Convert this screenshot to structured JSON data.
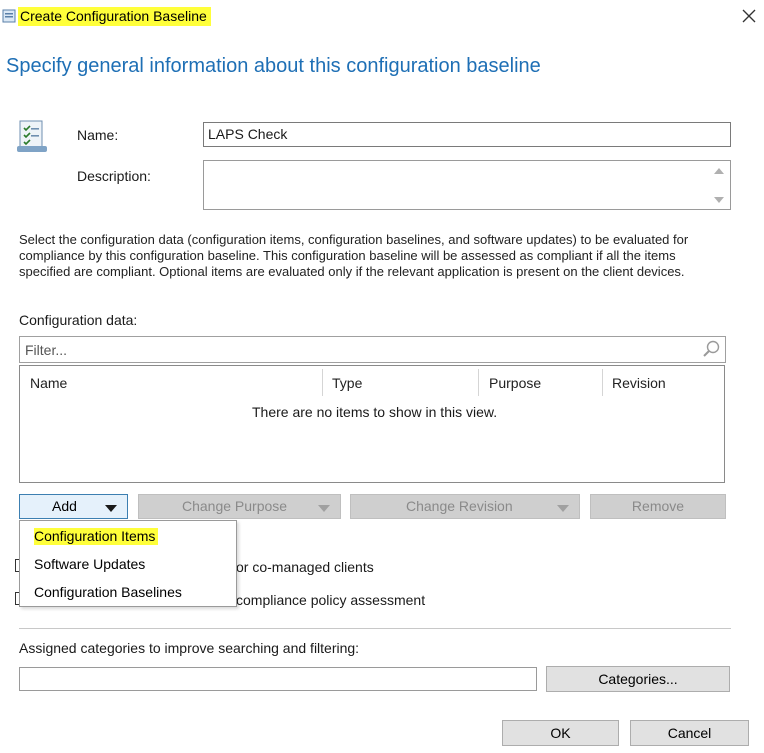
{
  "window": {
    "title": "Create Configuration Baseline",
    "heading": "Specify general information about this configuration baseline"
  },
  "form": {
    "name_label": "Name:",
    "name_value": "LAPS Check",
    "description_label": "Description:",
    "description_value": "",
    "info_line1": "Select the configuration data (configuration items, configuration baselines, and software updates) to be evaluated for",
    "info_line2": "compliance by this configuration baseline. This configuration baseline will be assessed as compliant if all the items",
    "info_line3": "specified are compliant. Optional items are evaluated only if the relevant application is present on  the client devices."
  },
  "config_data": {
    "label": "Configuration data:",
    "filter_placeholder": "Filter...",
    "columns": [
      "Name",
      "Type",
      "Purpose",
      "Revision"
    ],
    "empty_text": "There are no items to show in this view."
  },
  "buttons": {
    "add": "Add",
    "change_purpose": "Change Purpose",
    "change_revision": "Change Revision",
    "remove": "Remove",
    "categories": "Categories...",
    "ok": "OK",
    "cancel": "Cancel"
  },
  "add_menu": {
    "items": [
      "Configuration Items",
      "Software Updates",
      "Configuration Baselines"
    ]
  },
  "options": {
    "checkbox1_text_visible": "or co-managed clients",
    "checkbox2_text_visible": "compliance policy assessment"
  },
  "categories": {
    "label": "Assigned categories to improve searching and filtering:",
    "value": ""
  },
  "colors": {
    "highlight": "#ffff3a",
    "heading": "#1e6fb5"
  }
}
